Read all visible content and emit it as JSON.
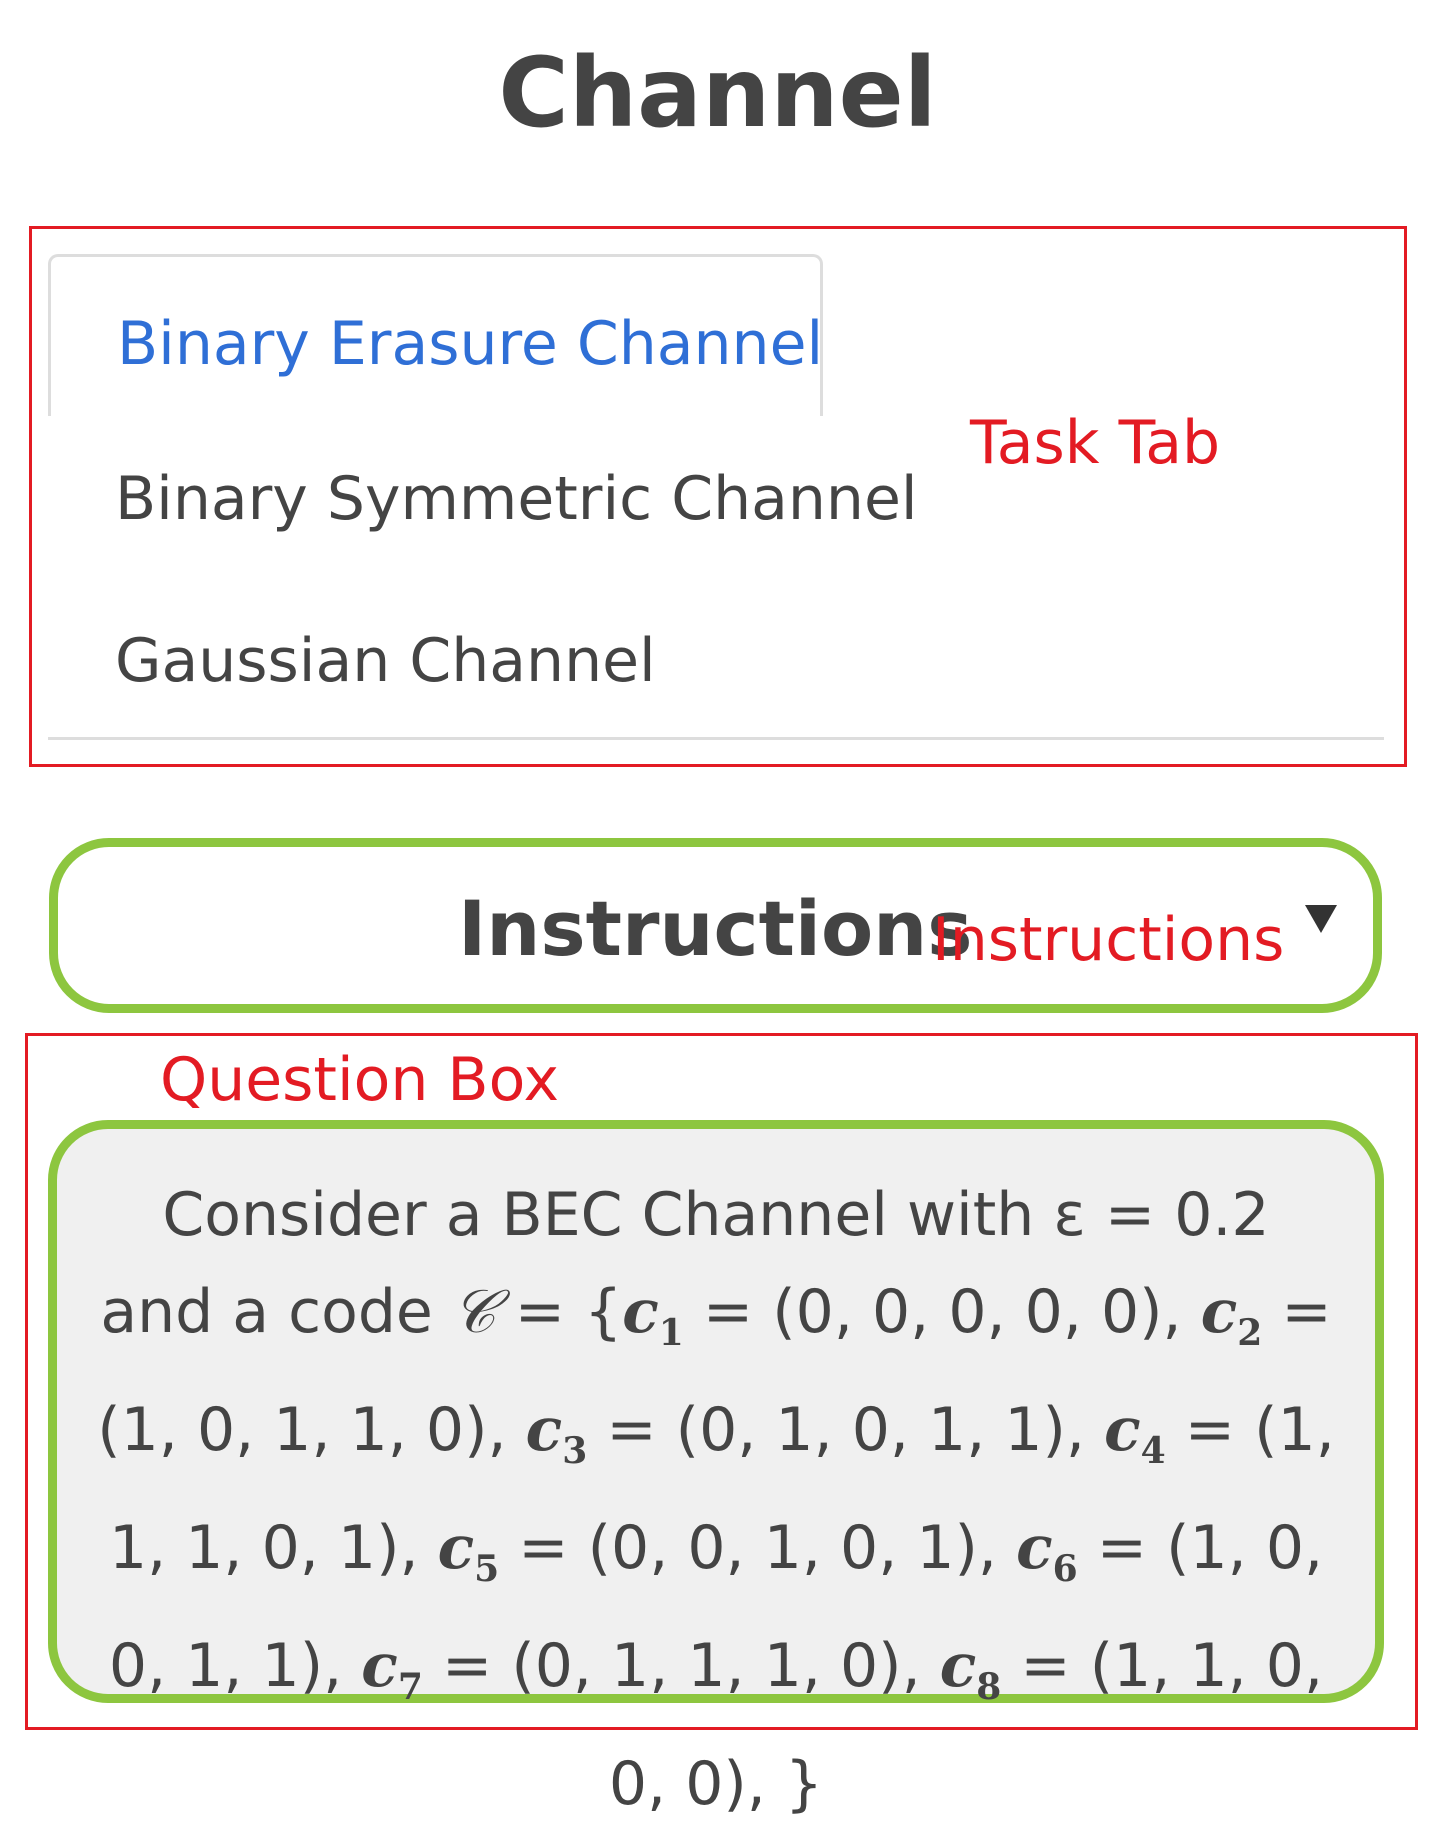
{
  "page": {
    "title": "Channel"
  },
  "annotations": {
    "task_tab": "Task Tab",
    "instructions": "Instructions",
    "question_box": "Question Box"
  },
  "tabs": [
    {
      "label": "Binary Erasure Channel",
      "active": true
    },
    {
      "label": "Binary Symmetric Channel",
      "active": false
    },
    {
      "label": "Gaussian Channel",
      "active": false
    }
  ],
  "instructions": {
    "title": "Instructions",
    "collapsed": true
  },
  "question": {
    "intro": "Consider a BEC Channel with ε = 0.2 and a code",
    "code_symbol": "𝒞",
    "codewords": [
      {
        "name": "c",
        "index": "1",
        "value": "(0, 0, 0, 0, 0)"
      },
      {
        "name": "c",
        "index": "2",
        "value": "(1, 0, 1, 1, 0)"
      },
      {
        "name": "c",
        "index": "3",
        "value": "(0, 1, 0, 1, 1)"
      },
      {
        "name": "c",
        "index": "4",
        "value": "(1, 1, 1, 0, 1)"
      },
      {
        "name": "c",
        "index": "5",
        "value": "(0, 0, 1, 0, 1)"
      },
      {
        "name": "c",
        "index": "6",
        "value": "(1, 0, 0, 1, 1)"
      },
      {
        "name": "c",
        "index": "7",
        "value": "(0, 1, 1, 1, 0)"
      },
      {
        "name": "c",
        "index": "8",
        "value": "(1, 1, 0, 0, 0)"
      }
    ]
  },
  "colors": {
    "active_tab_text": "#2f6fd6",
    "annotation_red": "#e31b23",
    "box_border_green": "#8dc63f",
    "question_bg": "#f0f0f0"
  }
}
